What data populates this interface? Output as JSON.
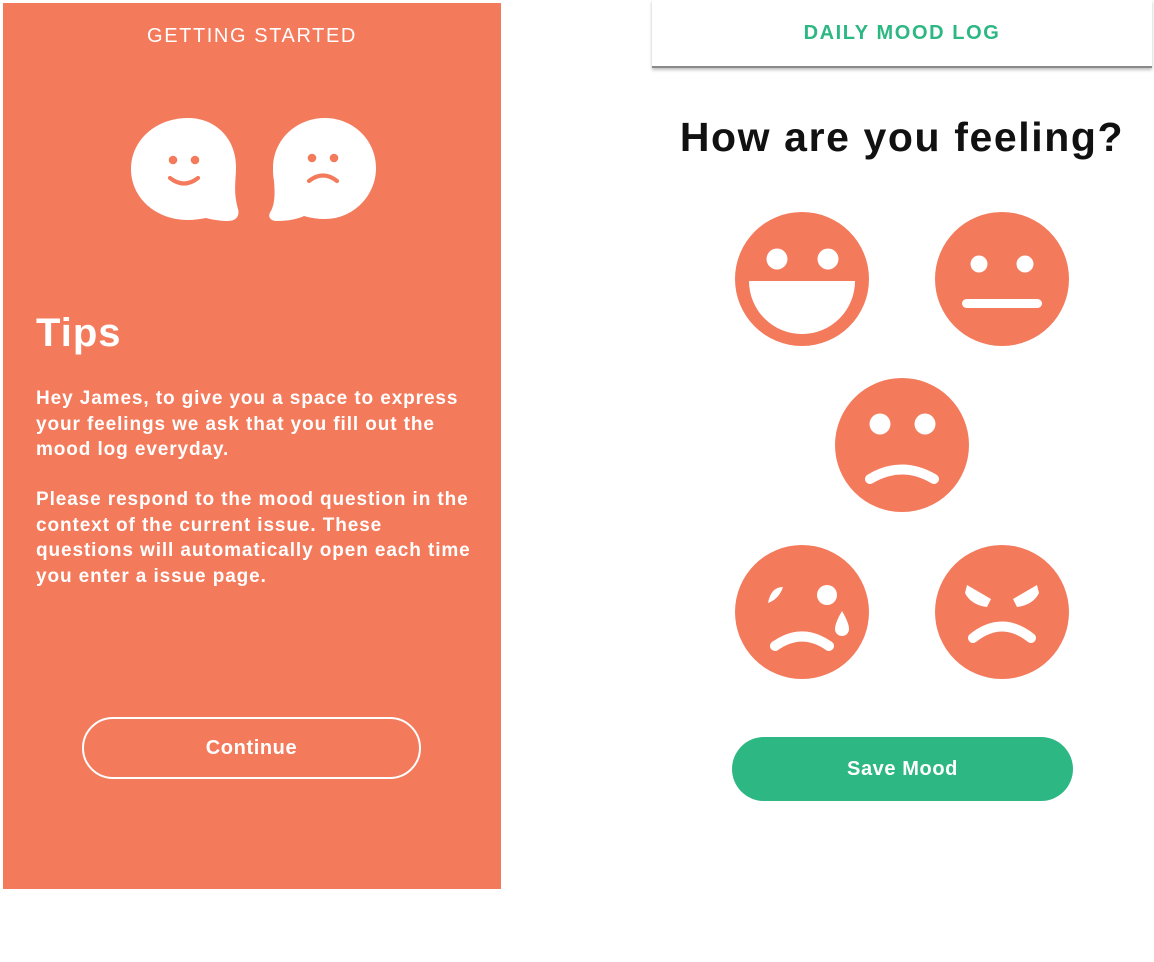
{
  "colors": {
    "accent": "#F47A5C",
    "green": "#2DB783"
  },
  "getting_started": {
    "header": "GETTING STARTED",
    "illustration_icons": [
      "happy-speech-bubble-icon",
      "sad-speech-bubble-icon"
    ],
    "tips_title": "Tips",
    "paragraph1": "Hey James, to give you a space to express your feelings we ask that you fill out the mood log everyday.",
    "paragraph2": "Please respond to the mood question in the context of the current issue. These questions will automatically open each time you enter a issue page.",
    "continue_label": "Continue"
  },
  "mood_log": {
    "header": "DAILY MOOD LOG",
    "question": "How are you feeling?",
    "moods": [
      "very-happy-face-icon",
      "neutral-face-icon",
      "sad-face-icon",
      "crying-face-icon",
      "angry-face-icon"
    ],
    "save_label": "Save Mood"
  }
}
